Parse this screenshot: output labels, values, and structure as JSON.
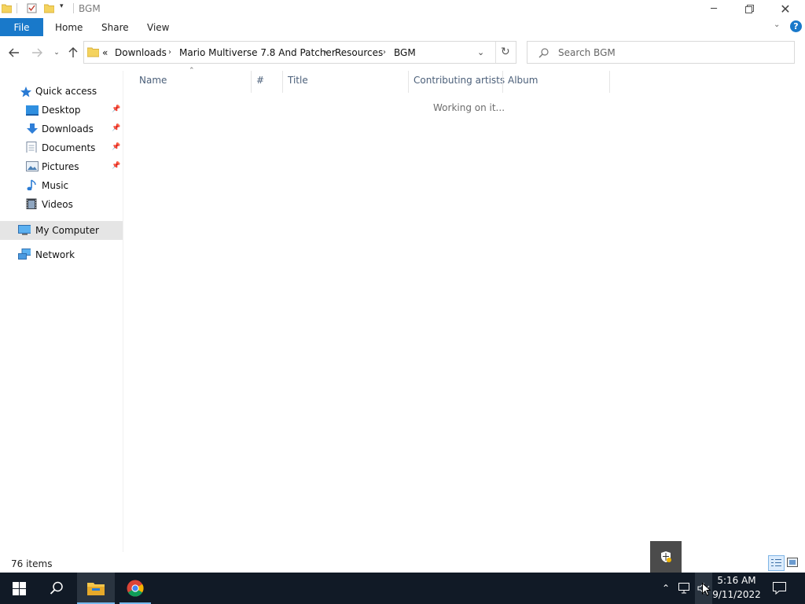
{
  "window": {
    "title": "BGM",
    "minimize_icon": "minimize-icon",
    "restore_icon": "restore-icon",
    "close_icon": "close-icon"
  },
  "ribbon": {
    "tabs": [
      {
        "label": "File"
      },
      {
        "label": "Home"
      },
      {
        "label": "Share"
      },
      {
        "label": "View"
      }
    ],
    "file_tab_color": "#1979ca"
  },
  "address": {
    "overflow": "«",
    "crumbs": [
      "Downloads",
      "Mario Multiverse 7.8 And Patcher",
      "Resources",
      "BGM"
    ]
  },
  "search": {
    "placeholder": "Search BGM"
  },
  "nav": {
    "quick_access": "Quick access",
    "items": [
      {
        "label": "Desktop",
        "pinned": true,
        "icon": "desktop-icon"
      },
      {
        "label": "Downloads",
        "pinned": true,
        "icon": "downloads-icon"
      },
      {
        "label": "Documents",
        "pinned": true,
        "icon": "documents-icon"
      },
      {
        "label": "Pictures",
        "pinned": true,
        "icon": "pictures-icon"
      },
      {
        "label": "Music",
        "pinned": false,
        "icon": "music-icon"
      },
      {
        "label": "Videos",
        "pinned": false,
        "icon": "videos-icon"
      }
    ],
    "this_pc": "My Computer",
    "network": "Network"
  },
  "columns": [
    "Name",
    "#",
    "Title",
    "Contributing artists",
    "Album"
  ],
  "content": {
    "status": "Working on it..."
  },
  "status_bar": {
    "item_count": "76 items"
  },
  "taskbar": {
    "time": "5:16 AM",
    "date": "9/11/2022"
  }
}
